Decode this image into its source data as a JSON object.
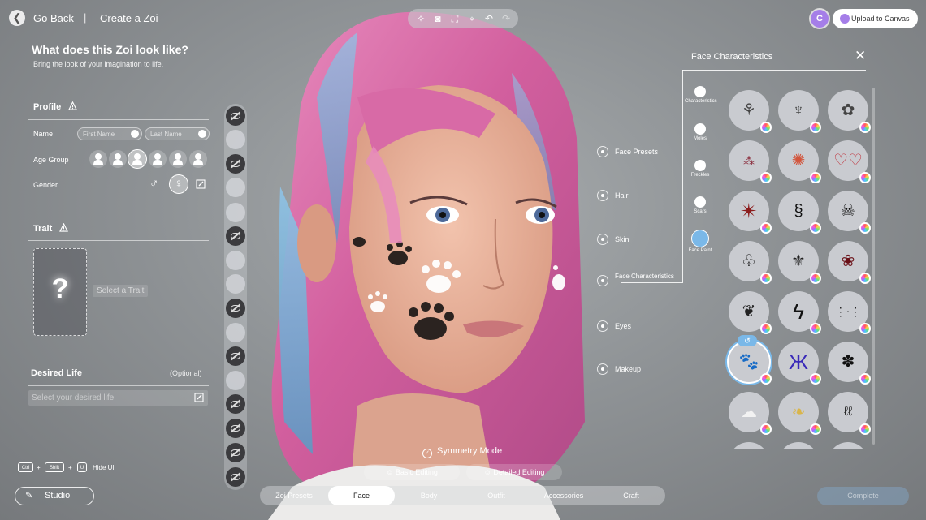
{
  "nav": {
    "back_label": "Go Back",
    "separator": "|",
    "title": "Create a Zoi"
  },
  "header": {
    "title": "What does this Zoi look like?",
    "subtitle": "Bring the look of your imagination to life."
  },
  "profile": {
    "heading": "Profile",
    "name_label": "Name",
    "first_name_placeholder": "First Name",
    "last_name_placeholder": "Last Name",
    "age_group_label": "Age Group",
    "age_groups": [
      "infant-icon",
      "child-icon",
      "teen-icon",
      "adult-icon",
      "senior-icon",
      "elder-icon"
    ],
    "gender_label": "Gender",
    "gender_male": "♂",
    "gender_female": "♀"
  },
  "trait": {
    "heading": "Trait",
    "placeholder_symbol": "?",
    "select_label": "Select a Trait"
  },
  "desired_life": {
    "heading": "Desired Life",
    "optional": "(Optional)",
    "placeholder": "Select your desired life"
  },
  "top_right": {
    "avatar_letter": "C",
    "upload_label": "Upload to Canvas"
  },
  "categories": [
    "Face Presets",
    "Hair",
    "Skin",
    "Face Characteristics",
    "Eyes",
    "Makeup"
  ],
  "face_panel": {
    "title": "Face Characteristics",
    "close": "✕",
    "tabs": [
      "Characteristics",
      "Moles",
      "Freckles",
      "Scars",
      "Face Paint"
    ],
    "active_tab": "Face Paint",
    "swatches": [
      "tulip-icon",
      "bird-icon",
      "flower-icon",
      "scatter-icon",
      "burst-icon",
      "hearts-icon",
      "star-icon",
      "dragon-icon",
      "skull-icon",
      "tattoo-icon",
      "moth-icon",
      "rose-icon",
      "vine-icon",
      "lightning-icon",
      "whiskers-icon",
      "paw-icon",
      "butterfly-icon",
      "flowers-icon",
      "clouds-icon",
      "wings-icon",
      "script-icon"
    ],
    "selected_swatch": "paw-icon",
    "undo_symbol": "↺"
  },
  "bottom": {
    "symmetry_label": "Symmetry Mode",
    "basic_editing": "Basic Editing",
    "detailed_editing": "Detailed Editing",
    "tabs": [
      "Zoi Presets",
      "Face",
      "Body",
      "Outfit",
      "Accessories",
      "Craft"
    ],
    "active_tab": "Face",
    "shortcut_keys": [
      "Ctrl",
      "Shift",
      "U"
    ],
    "shortcut_plus": "+",
    "shortcut_label": "Hide UI",
    "studio_label": "Studio",
    "complete_label": "Complete"
  },
  "colors": {
    "accent": "#7ab8e8",
    "brand": "#a57ee8"
  }
}
